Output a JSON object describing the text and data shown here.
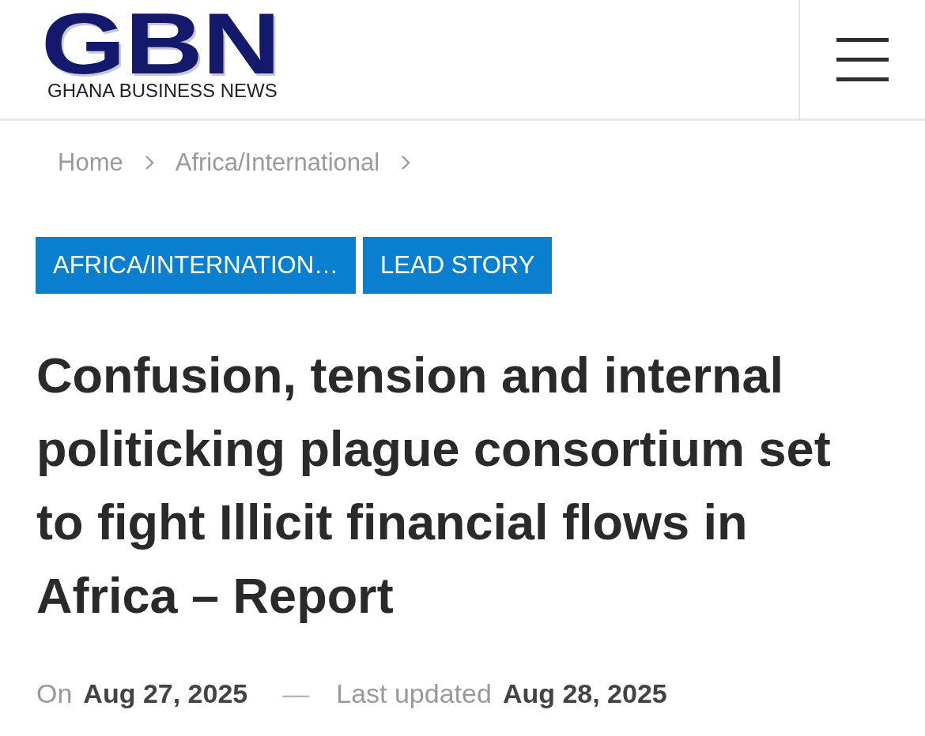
{
  "header": {
    "logo": {
      "wordmark": "GBN",
      "tagline": "GHANA BUSINESS NEWS"
    }
  },
  "breadcrumb": [
    {
      "label": "Home"
    },
    {
      "label": "Africa/International"
    }
  ],
  "tags": [
    {
      "label": "AFRICA/INTERNATION…"
    },
    {
      "label": "LEAD STORY"
    }
  ],
  "article": {
    "title": "Confusion, tension and internal politicking plague consortium set to fight Illicit financial flows in Africa – Report",
    "meta": {
      "published_label": "On",
      "published_date": "Aug 27, 2025",
      "separator": "—",
      "updated_label": "Last updated",
      "updated_date": "Aug 28, 2025"
    }
  }
}
